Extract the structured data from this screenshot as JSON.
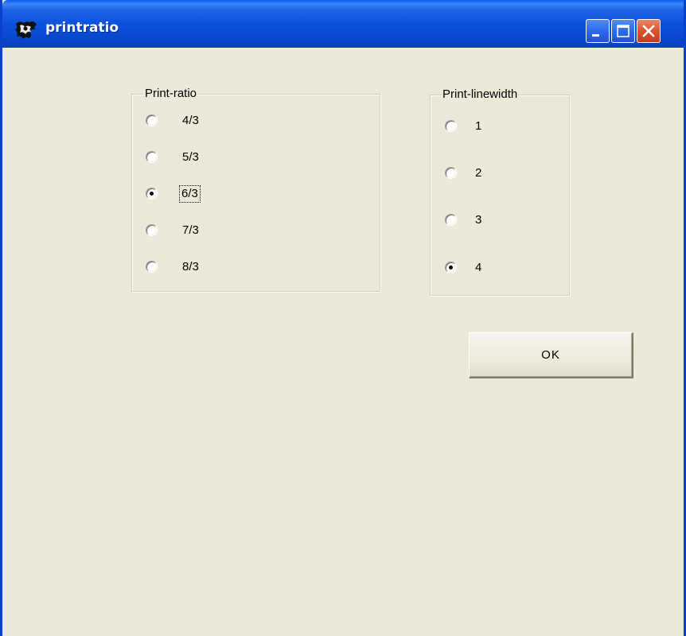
{
  "window": {
    "title": "printratio",
    "icon": "app-icon",
    "controls": {
      "minimize_icon": "minimize-icon",
      "maximize_icon": "maximize-icon",
      "close_icon": "close-icon"
    }
  },
  "print_ratio": {
    "legend": "Print-ratio",
    "options": [
      {
        "label": "4/3",
        "checked": false
      },
      {
        "label": "5/3",
        "checked": false
      },
      {
        "label": "6/3",
        "checked": true
      },
      {
        "label": "7/3",
        "checked": false
      },
      {
        "label": "8/3",
        "checked": false
      }
    ]
  },
  "print_linewidth": {
    "legend": "Print-linewidth",
    "options": [
      {
        "label": "1",
        "checked": false
      },
      {
        "label": "2",
        "checked": false
      },
      {
        "label": "3",
        "checked": false
      },
      {
        "label": "4",
        "checked": true
      }
    ]
  },
  "ok_button": {
    "label": "OK"
  },
  "colors": {
    "titlebar": "#0A4FDC",
    "window_background": "#ECE9D8",
    "close_button": "#D9542E"
  }
}
